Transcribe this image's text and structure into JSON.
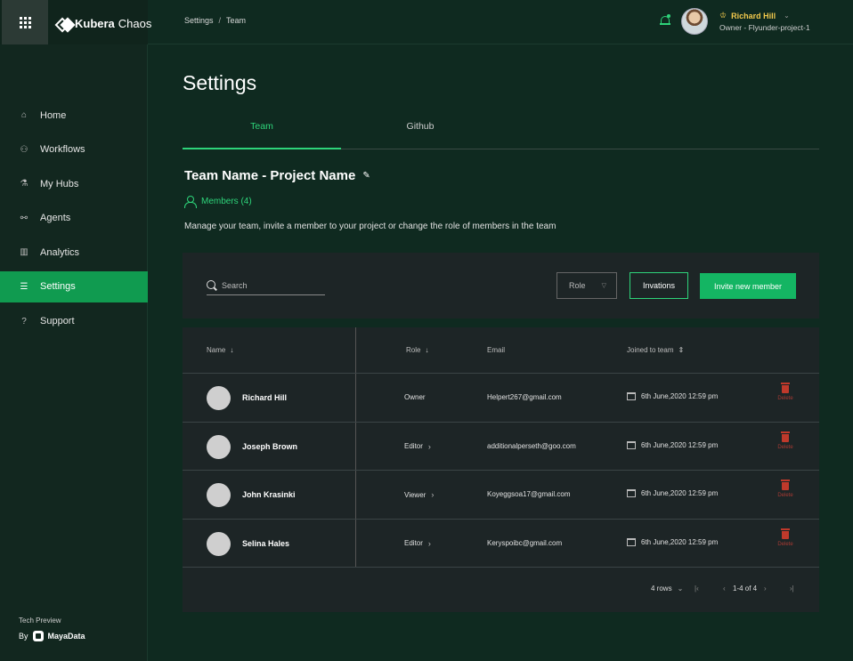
{
  "brand": {
    "name_bold": "Kubera",
    "name_light": "Chaos"
  },
  "sidebar": {
    "items": [
      {
        "label": "Home",
        "icon": "home-icon",
        "glyph": "⌂"
      },
      {
        "label": "Workflows",
        "icon": "workflows-icon",
        "glyph": "⚇"
      },
      {
        "label": "My Hubs",
        "icon": "flask-icon",
        "glyph": "⚗"
      },
      {
        "label": "Agents",
        "icon": "link-icon",
        "glyph": "⚯"
      },
      {
        "label": "Analytics",
        "icon": "analytics-icon",
        "glyph": "▥"
      },
      {
        "label": "Settings",
        "icon": "sliders-icon",
        "glyph": "☰"
      },
      {
        "label": "Support",
        "icon": "help-icon",
        "glyph": "?"
      }
    ],
    "active": "Settings",
    "footer": {
      "tech": "Tech Preview",
      "by": "By",
      "company": "MayaData"
    }
  },
  "header": {
    "breadcrumb": [
      "Settings",
      "Team"
    ],
    "user": {
      "name": "Richard Hill",
      "role": "Owner - Flyunder-project-1"
    }
  },
  "main": {
    "title": "Settings",
    "tabs": [
      {
        "label": "Team",
        "active": true
      },
      {
        "label": "Github",
        "active": false
      }
    ],
    "team_title": "Team Name - Project Name",
    "members_label": "Members (4)",
    "description": "Manage your team, invite a member to your project or change the role of members in the team",
    "toolbar": {
      "search_placeholder": "Search",
      "role_label": "Role",
      "invitations_label": "Invations",
      "invite_label": "Invite new member"
    },
    "table": {
      "headers": {
        "name": "Name",
        "role": "Role",
        "email": "Email",
        "joined": "Joined to team"
      },
      "rows": [
        {
          "name": "Richard Hill",
          "role": "Owner",
          "role_editable": false,
          "email": "Helpert267@gmail.com",
          "joined": "6th June,2020 12:59 pm",
          "delete": "Delete"
        },
        {
          "name": "Joseph Brown",
          "role": "Editor",
          "role_editable": true,
          "email": "additionalperseth@goo.com",
          "joined": "6th June,2020 12:59 pm",
          "delete": "Delete"
        },
        {
          "name": "John Krasinki",
          "role": "Viewer",
          "role_editable": true,
          "email": "Koyeggsoa17@gmail.com",
          "joined": "6th June,2020 12:59 pm",
          "delete": "Delete"
        },
        {
          "name": "Selina Hales",
          "role": "Editor",
          "role_editable": true,
          "email": "Keryspoibc@gmail.com",
          "joined": "6th June,2020 12:59 pm",
          "delete": "Delete"
        }
      ],
      "pagination": {
        "rows_per_page": "4 rows",
        "range": "1-4 of 4"
      }
    }
  },
  "colors": {
    "accent": "#2ed47a",
    "active_nav": "#109b50",
    "danger": "#c0392b",
    "user_name": "#f2c94c"
  }
}
